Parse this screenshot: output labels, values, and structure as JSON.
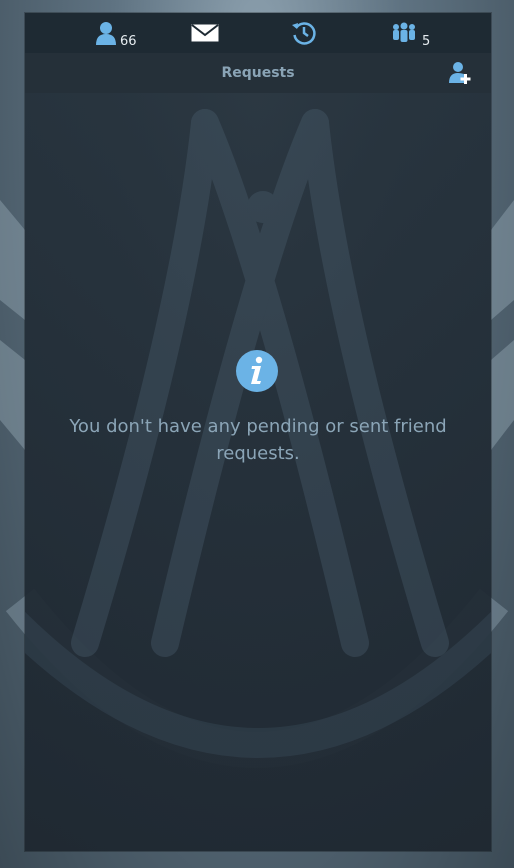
{
  "tabs": [
    {
      "id": "friends",
      "icon": "person-icon",
      "count": "66"
    },
    {
      "id": "messages",
      "icon": "envelope-icon"
    },
    {
      "id": "recent",
      "icon": "history-icon"
    },
    {
      "id": "groups",
      "icon": "group-icon",
      "count": "5"
    }
  ],
  "header": {
    "title": "Requests",
    "add_icon": "add-friend-icon"
  },
  "empty_state": {
    "icon": "info-icon",
    "message": "You don't have any pending or sent friend requests."
  },
  "colors": {
    "accent_blue": "#6bb3e6",
    "panel": "#1e2a33",
    "text_muted": "#8ba5b7"
  }
}
